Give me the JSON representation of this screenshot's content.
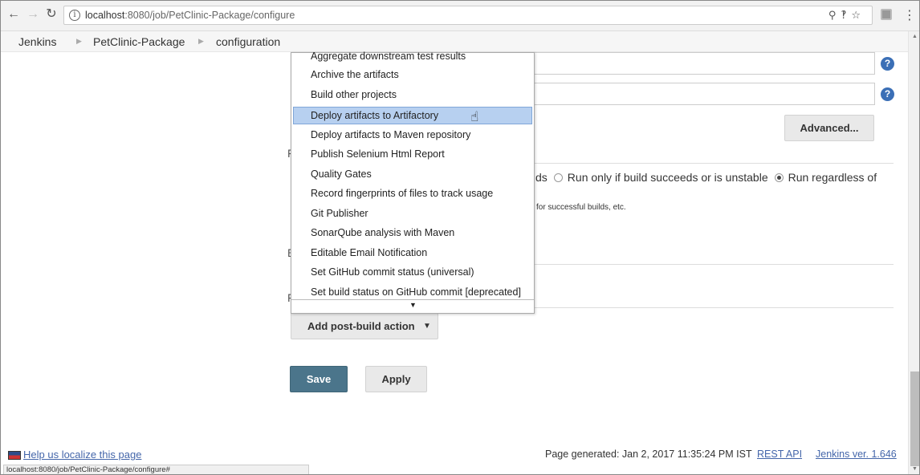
{
  "browser": {
    "url_host": "localhost",
    "url_rest": ":8080/job/PetClinic-Package/configure",
    "status_url": "localhost:8080/job/PetClinic-Package/configure#"
  },
  "breadcrumb": {
    "items": [
      "Jenkins",
      "PetClinic-Package",
      "configuration"
    ]
  },
  "main": {
    "advanced_label": "Advanced...",
    "radio_options": {
      "opt1_tail": "ds",
      "opt2": "Run only if build succeeds or is unstable",
      "opt3": "Run regardless of"
    },
    "note": "for successful builds, etc.",
    "add_post_build_label": "Add post-build action",
    "save_label": "Save",
    "apply_label": "Apply"
  },
  "dropdown": {
    "items": [
      "Aggregate downstream test results",
      "Archive the artifacts",
      "Build other projects",
      "Deploy artifacts to Artifactory",
      "Deploy artifacts to Maven repository",
      "Publish Selenium Html Report",
      "Quality Gates",
      "Record fingerprints of files to track usage",
      "Git Publisher",
      "SonarQube analysis with Maven",
      "Editable Email Notification",
      "Set GitHub commit status (universal)",
      "Set build status on GitHub commit [deprecated]"
    ],
    "selected_index": 3
  },
  "footer": {
    "localize": "Help us localize this page",
    "generated": "Page generated: Jan 2, 2017 11:35:24 PM IST",
    "rest_api": "REST API",
    "jenkins_version": "Jenkins ver. 1.646"
  }
}
